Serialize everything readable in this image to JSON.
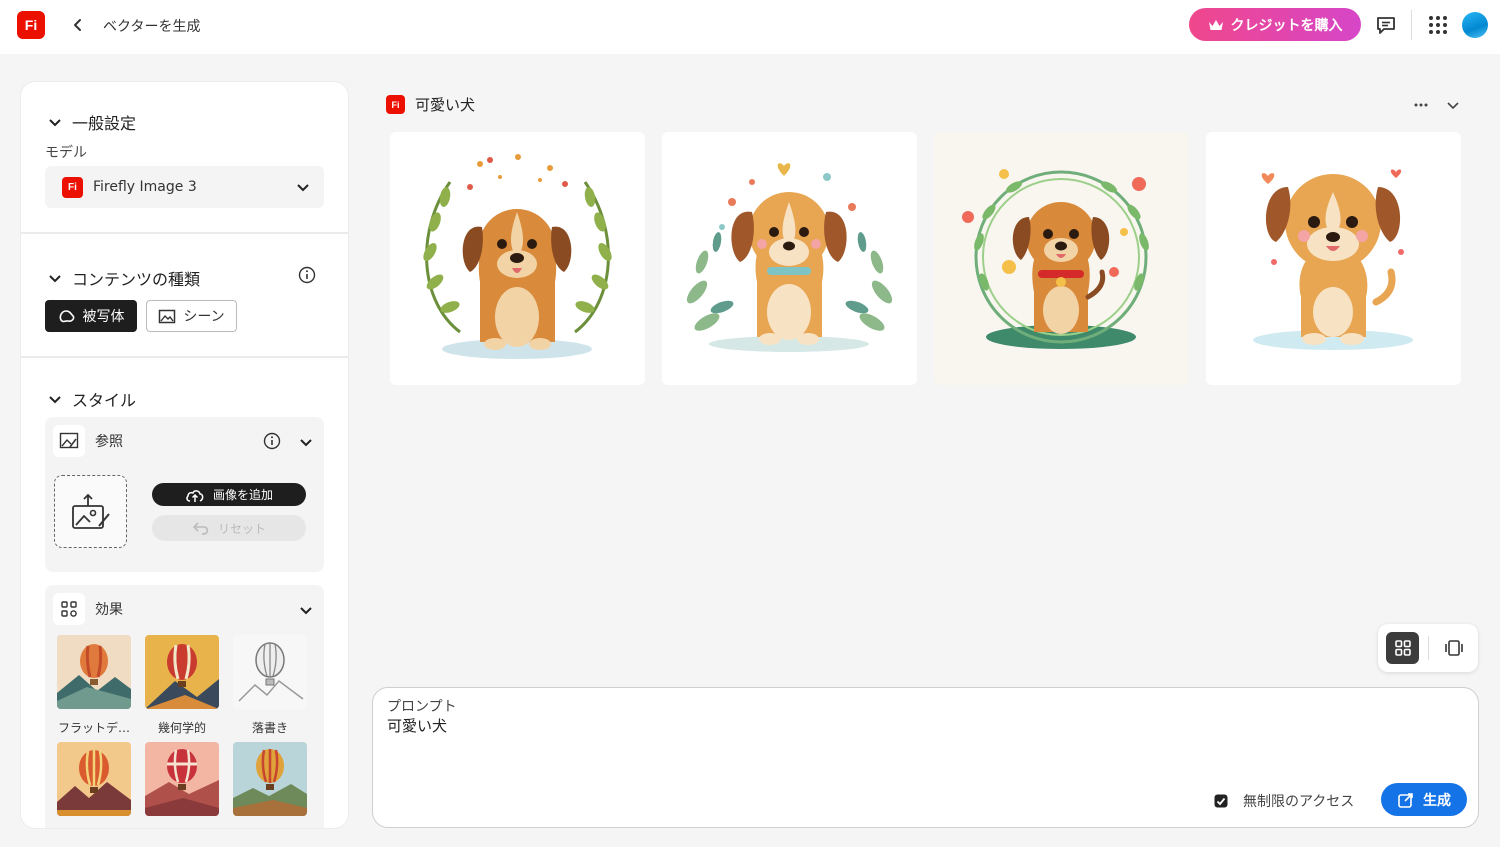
{
  "app": {
    "logo_text": "Fi",
    "page_title": "ベクターを生成",
    "buy_credits": "クレジットを購入"
  },
  "colors": {
    "brand_red": "#eb1000",
    "buy_gradient_start": "#f0478c",
    "buy_gradient_end": "#d646c8",
    "generate_blue": "#1473e6",
    "dark_button": "#1e1e1e"
  },
  "panel": {
    "general": {
      "heading": "一般設定",
      "model_label": "モデル",
      "model_value": "Firefly Image 3"
    },
    "content_type": {
      "heading": "コンテンツの種類",
      "subject": "被写体",
      "scene": "シーン",
      "selected": "被写体"
    },
    "style": {
      "heading": "スタイル",
      "reference": {
        "label": "参照",
        "add_image": "画像を追加",
        "reset": "リセット"
      },
      "effects": {
        "label": "効果",
        "items": [
          {
            "label": "フラットデ…"
          },
          {
            "label": "幾何学的"
          },
          {
            "label": "落書き"
          },
          {
            "label": ""
          },
          {
            "label": ""
          },
          {
            "label": ""
          }
        ]
      }
    }
  },
  "main": {
    "title": "可愛い犬",
    "results": [
      {
        "icon": "puppy-laurel-wreath-image"
      },
      {
        "icon": "puppy-leaves-image"
      },
      {
        "icon": "puppy-flower-wreath-image"
      },
      {
        "icon": "puppy-hearts-image"
      }
    ]
  },
  "prompt": {
    "label": "プロンプト",
    "value": "可愛い犬",
    "access": "無制限のアクセス",
    "generate": "生成"
  }
}
